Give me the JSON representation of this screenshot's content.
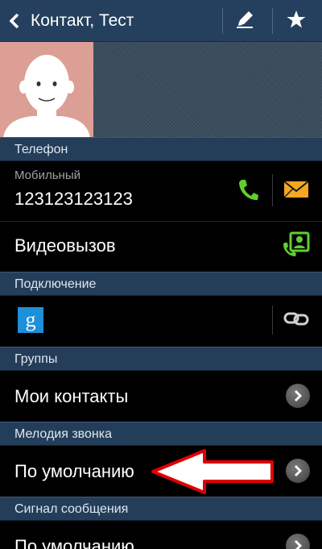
{
  "header": {
    "title": "Контакт, Тест"
  },
  "sections": {
    "phone": "Телефон",
    "connection": "Подключение",
    "groups": "Группы",
    "ringtone": "Мелодия звонка",
    "message_signal": "Сигнал сообщения"
  },
  "phone_row": {
    "label": "Мобильный",
    "number": "123123123123"
  },
  "video_call": {
    "label": "Видеовызов"
  },
  "groups_row": {
    "value": "Мои контакты"
  },
  "ringtone_row": {
    "value": "По умолчанию"
  },
  "message_signal_row": {
    "value": "По умолчанию"
  },
  "colors": {
    "header_bg": "#24405e",
    "section_bg": "#243e5a",
    "call_green": "#5fcf2f",
    "message_orange": "#f5a623",
    "annotation_arrow": "#e00000"
  },
  "annotation": {
    "type": "red-arrow-pointing-left",
    "target": "ringtone_row"
  }
}
